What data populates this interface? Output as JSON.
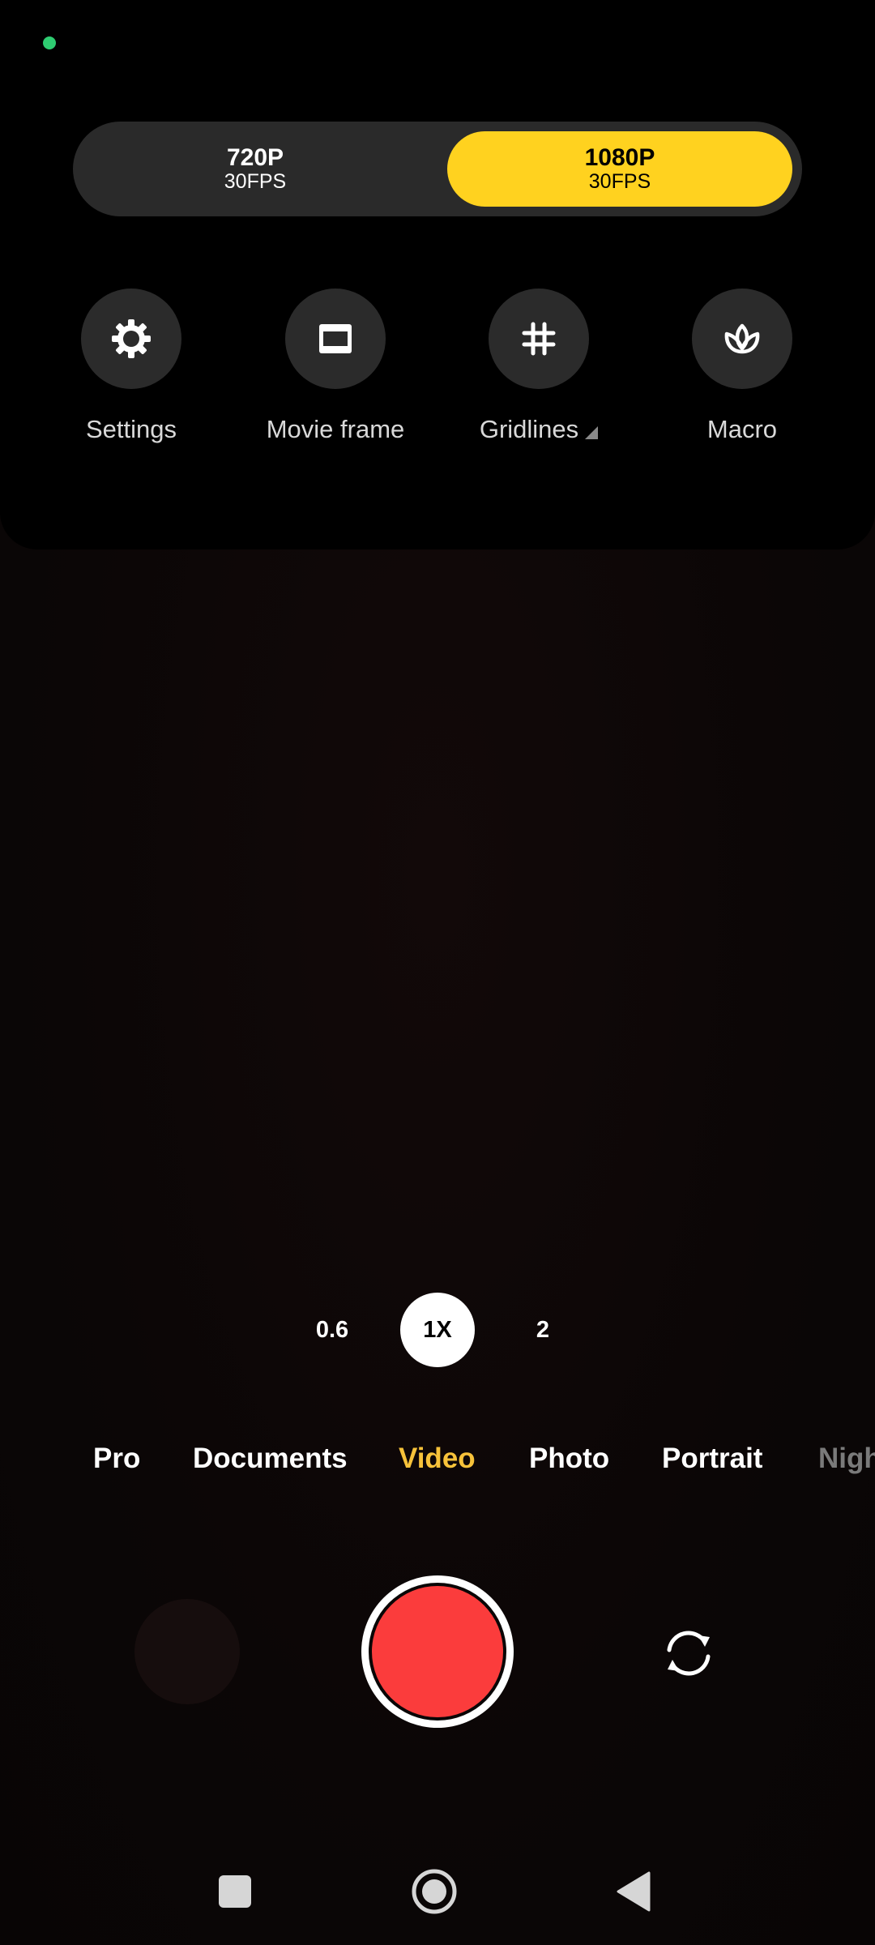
{
  "resolution": {
    "options": [
      {
        "label": "720P",
        "sub": "30FPS"
      },
      {
        "label": "1080P",
        "sub": "30FPS"
      }
    ],
    "selected": 1,
    "accent": "#ffd21f"
  },
  "quick_settings": [
    {
      "label": "Settings",
      "icon": "gear-icon"
    },
    {
      "label": "Movie frame",
      "icon": "movie-frame-icon"
    },
    {
      "label": "Gridlines",
      "icon": "grid-icon"
    },
    {
      "label": "Macro",
      "icon": "flower-icon"
    }
  ],
  "zoom": {
    "levels": [
      "0.6",
      "1X",
      "2"
    ],
    "selected": 1
  },
  "modes": {
    "items": [
      "Pro",
      "Documents",
      "Video",
      "Photo",
      "Portrait",
      "Night"
    ],
    "selected": "Video",
    "accent": "#f7c23a"
  },
  "controls": {
    "record_color": "#fb3c3c",
    "flip_icon": "camera-switch-icon"
  },
  "nav": {
    "icons": [
      "recents-icon",
      "home-icon",
      "back-icon"
    ]
  },
  "status": {
    "indicator_color": "#2ecc71"
  }
}
